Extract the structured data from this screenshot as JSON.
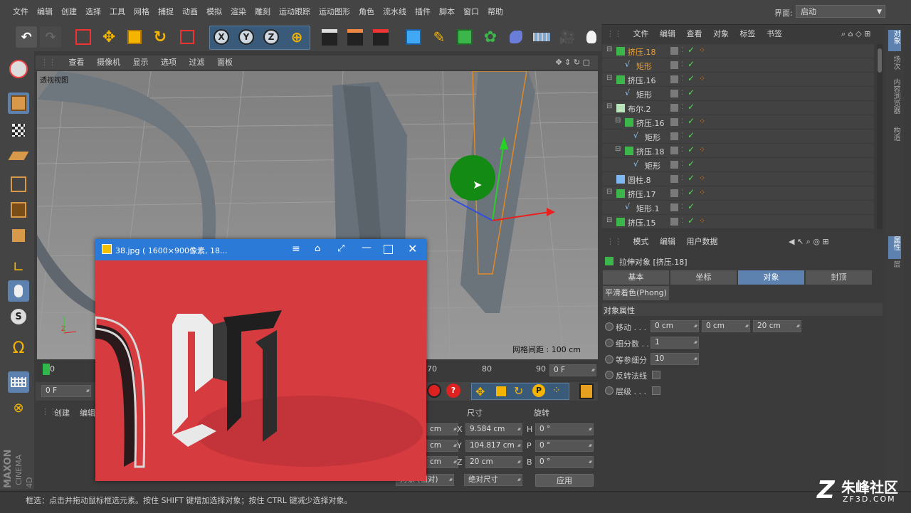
{
  "menubar": {
    "items": [
      "文件",
      "编辑",
      "创建",
      "选择",
      "工具",
      "网格",
      "捕捉",
      "动画",
      "模拟",
      "渲染",
      "雕刻",
      "运动跟踪",
      "运动图形",
      "角色",
      "流水线",
      "插件",
      "脚本",
      "窗口",
      "帮助"
    ],
    "layout_label": "界面:",
    "layout_value": "启动"
  },
  "viewport": {
    "menu": [
      "查看",
      "摄像机",
      "显示",
      "选项",
      "过滤",
      "面板"
    ],
    "name": "透视视图",
    "grid_info": "网格间距 : 100 cm"
  },
  "timeline": {
    "start_frame": "0",
    "ticks": [
      "70",
      "80",
      "90"
    ],
    "current_frame": "0 F",
    "left_field": "0 F"
  },
  "object_manager": {
    "menu": [
      "文件",
      "编辑",
      "查看",
      "对象",
      "标签",
      "书签"
    ],
    "rows": [
      {
        "name": "挤压.18",
        "type": "extrude",
        "indent": 0,
        "selected": true,
        "tags": true
      },
      {
        "name": "矩形",
        "type": "spline",
        "indent": 1,
        "selected": true,
        "tags": false
      },
      {
        "name": "挤压.16",
        "type": "extrude",
        "indent": 0,
        "selected": false,
        "tags": true
      },
      {
        "name": "矩形",
        "type": "spline",
        "indent": 1,
        "selected": false,
        "tags": false
      },
      {
        "name": "布尔.2",
        "type": "boole",
        "indent": 0,
        "selected": false,
        "tags": false
      },
      {
        "name": "挤压.16",
        "type": "extrude",
        "indent": 1,
        "selected": false,
        "tags": true
      },
      {
        "name": "矩形",
        "type": "spline",
        "indent": 2,
        "selected": false,
        "tags": false
      },
      {
        "name": "挤压.18",
        "type": "extrude",
        "indent": 1,
        "selected": false,
        "tags": true
      },
      {
        "name": "矩形",
        "type": "spline",
        "indent": 2,
        "selected": false,
        "tags": false
      },
      {
        "name": "圆柱.8",
        "type": "cylinder",
        "indent": 0,
        "selected": false,
        "tags": true
      },
      {
        "name": "挤压.17",
        "type": "extrude",
        "indent": 0,
        "selected": false,
        "tags": true
      },
      {
        "name": "矩形.1",
        "type": "spline",
        "indent": 1,
        "selected": false,
        "tags": false
      },
      {
        "name": "挤压.15",
        "type": "extrude",
        "indent": 0,
        "selected": false,
        "tags": true
      }
    ]
  },
  "right_tabs": [
    "对象",
    "场次",
    "内容浏览器",
    "构造",
    "属性",
    "层"
  ],
  "attributes": {
    "menu": [
      "模式",
      "编辑",
      "用户数据"
    ],
    "title": "拉伸对象 [挤压.18]",
    "tabs": [
      "基本",
      "坐标",
      "对象",
      "封顶"
    ],
    "active_tab": "对象",
    "subtab": "平滑着色(Phong)",
    "section": "对象属性",
    "move_label": "移动 . . .",
    "move_x": "0 cm",
    "move_y": "0 cm",
    "move_z": "20 cm",
    "subdiv_label": "细分数 . .",
    "subdiv_value": "1",
    "iso_label": "等参细分",
    "iso_value": "10",
    "flip_label": "反转法线",
    "layer_label": "层级 . . ."
  },
  "coord_manager": {
    "tabs": [
      "创建",
      "编辑"
    ],
    "size_header": "尺寸",
    "rot_header": "旋转",
    "pos_fields": [
      "cm",
      "cm",
      "cm"
    ],
    "size_x_label": "X",
    "size_x": "9.584 cm",
    "size_y_label": "Y",
    "size_y": "104.817 cm",
    "size_z_label": "Z",
    "size_z": "20 cm",
    "rot_h_label": "H",
    "rot_h": "0 °",
    "rot_p_label": "P",
    "rot_p": "0 °",
    "rot_b_label": "B",
    "rot_b": "0 °",
    "mode_select": "对象 (相对)",
    "size_select": "绝对尺寸",
    "apply": "应用"
  },
  "status_text": "框选：点击并拖动鼠标框选元素。按住 SHIFT 键增加选择对象；按住 CTRL 键减少选择对象。",
  "image_viewer": {
    "title": "38.jpg ( 1600×900像素, 18..."
  },
  "branding": {
    "maxon": "MAXON",
    "cinema": "CINEMA 4D",
    "watermark_cn": "朱峰社区",
    "watermark_url": "ZF3D.COM"
  },
  "colors": {
    "accent_blue": "#5d82b0",
    "selected_text": "#f0a030",
    "viewer_bg": "#d33d42",
    "viewer_title": "#2b7ad8"
  }
}
